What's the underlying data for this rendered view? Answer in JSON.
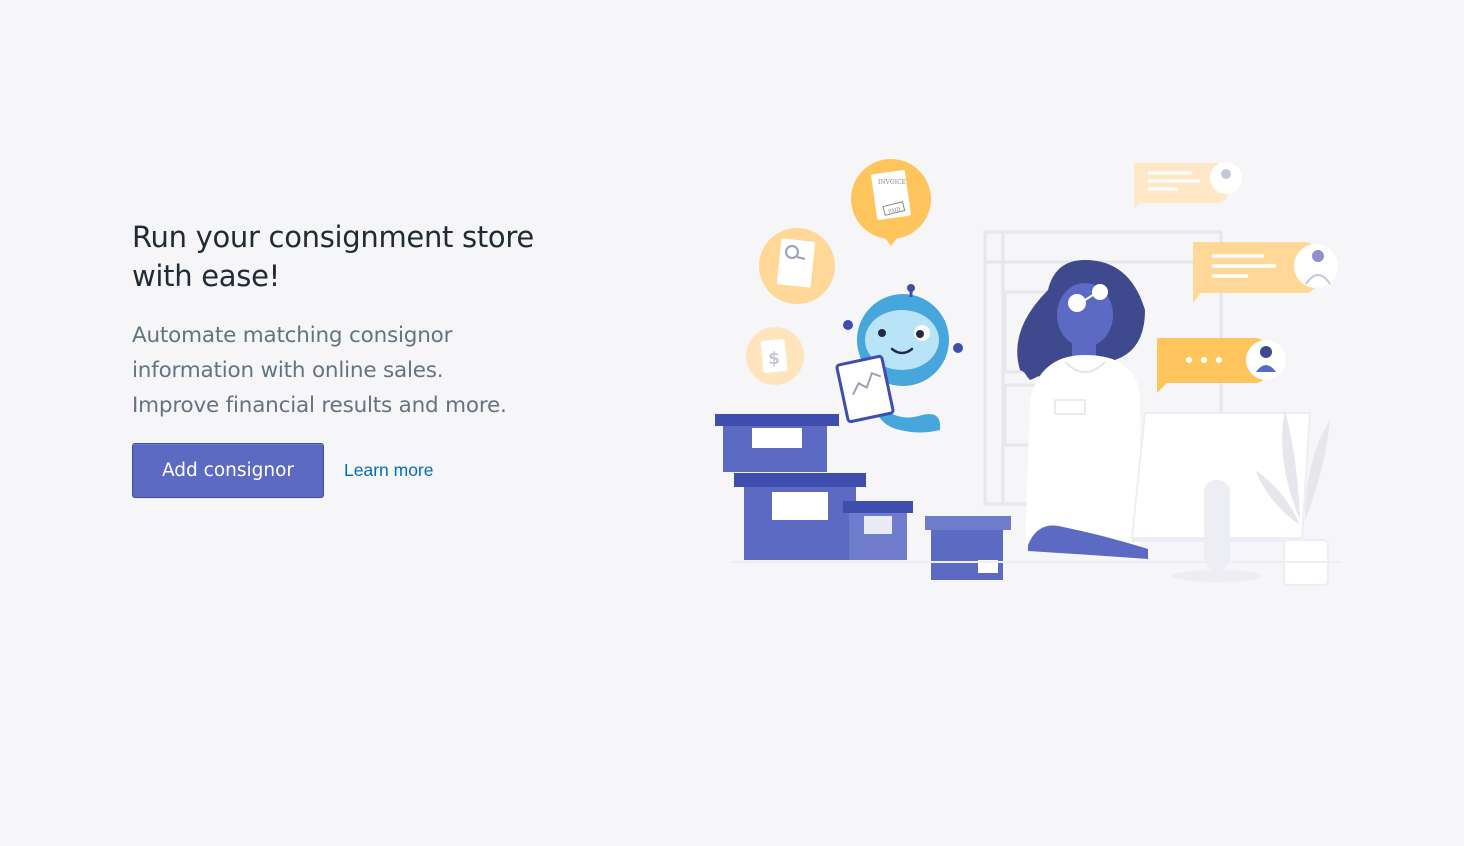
{
  "hero": {
    "title_line1": "Run your consignment store",
    "title_line2": "with ease!",
    "desc_line1": "Automate matching consignor",
    "desc_line2": "information with online sales.",
    "desc_line3": "Improve financial results and more."
  },
  "actions": {
    "primary_label": "Add consignor",
    "secondary_label": "Learn more"
  },
  "illustration": {
    "invoice_label": "INVOICE",
    "paid_stamp": "PAID",
    "dollar_glyph": "$",
    "colors": {
      "brand": "#5c6ac4",
      "robot": "#47a6dc",
      "accent": "#ffc45c",
      "bubble": "#ffd9a0"
    }
  }
}
